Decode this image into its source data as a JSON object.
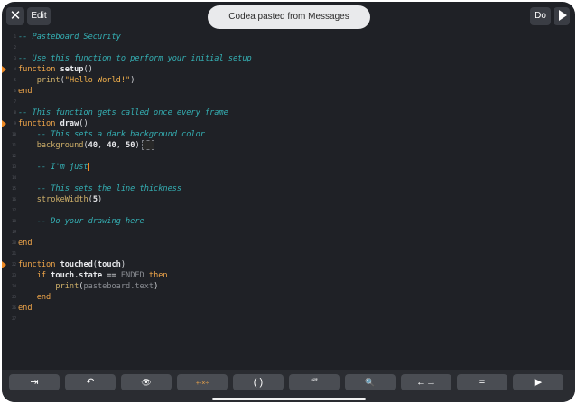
{
  "topbar": {
    "close_glyph": "✕",
    "edit_label": "Edit",
    "toast_text": "Codea pasted from Messages",
    "do_label": "Do"
  },
  "toolbar": {
    "keys": [
      {
        "name": "tab-key",
        "glyph": "⇥",
        "icon": "tab-arrow-icon"
      },
      {
        "name": "undo-key",
        "glyph": "↶",
        "icon": "undo-icon"
      },
      {
        "name": "preview-key",
        "glyph": "👁",
        "icon": "eye-icon"
      },
      {
        "name": "operators-key",
        "glyph": "+-×÷",
        "icon": "math-operators-icon"
      },
      {
        "name": "parentheses-key",
        "glyph": "( )",
        "icon": "parentheses-icon"
      },
      {
        "name": "quotes-key",
        "glyph": "“”",
        "icon": "quotes-icon"
      },
      {
        "name": "search-key",
        "glyph": "🔍",
        "icon": "search-icon"
      },
      {
        "name": "cursor-move-key",
        "glyph": "←→",
        "icon": "cursor-arrows-icon"
      },
      {
        "name": "equals-key",
        "glyph": "=",
        "icon": "equals-icon"
      },
      {
        "name": "run-key",
        "glyph": "▶",
        "icon": "play-icon"
      }
    ]
  },
  "code": {
    "lines": [
      {
        "n": "1",
        "t": "-- Pasteboard Security"
      },
      {
        "n": "2",
        "t": ""
      },
      {
        "n": "3",
        "t": "-- Use this function to perform your initial setup"
      },
      {
        "n": "4",
        "t": "function setup()"
      },
      {
        "n": "5",
        "t": "    print(\"Hello World!\")"
      },
      {
        "n": "6",
        "t": "end"
      },
      {
        "n": "7",
        "t": ""
      },
      {
        "n": "8",
        "t": "-- This function gets called once every frame"
      },
      {
        "n": "9",
        "t": "function draw()"
      },
      {
        "n": "10",
        "t": "    -- This sets a dark background color"
      },
      {
        "n": "11",
        "t": "    background(40, 40, 50)"
      },
      {
        "n": "12",
        "t": ""
      },
      {
        "n": "13",
        "t": "    -- I'm just"
      },
      {
        "n": "14",
        "t": ""
      },
      {
        "n": "15",
        "t": "    -- This sets the line thickness"
      },
      {
        "n": "16",
        "t": "    strokeWidth(5)"
      },
      {
        "n": "17",
        "t": ""
      },
      {
        "n": "18",
        "t": "    -- Do your drawing here"
      },
      {
        "n": "19",
        "t": ""
      },
      {
        "n": "20",
        "t": "end"
      },
      {
        "n": "21",
        "t": ""
      },
      {
        "n": "22",
        "t": "function touched(touch)"
      },
      {
        "n": "23",
        "t": "    if touch.state == ENDED then"
      },
      {
        "n": "24",
        "t": "        print(pasteboard.text)"
      },
      {
        "n": "25",
        "t": "    end"
      },
      {
        "n": "26",
        "t": "end"
      },
      {
        "n": "27",
        "t": ""
      }
    ]
  },
  "colors": {
    "background": "#1f2126",
    "comment": "#35b2b6",
    "keyword": "#f0a64a",
    "marker": "#f08a24",
    "toast": "#e9eaec"
  }
}
